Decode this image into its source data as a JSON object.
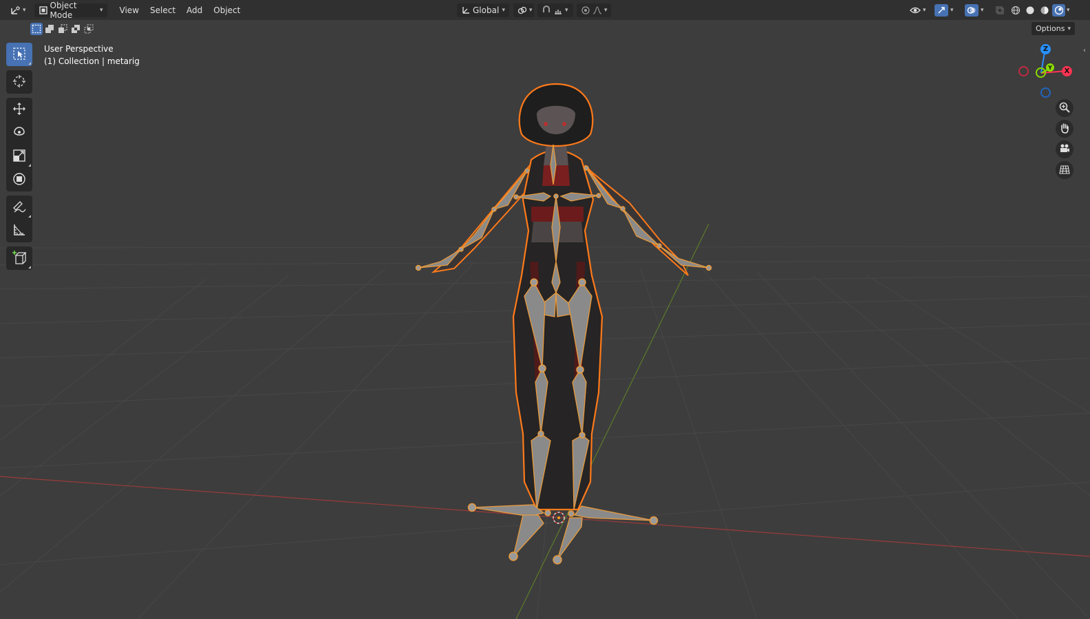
{
  "header": {
    "mode_label": "Object Mode",
    "menus": [
      "View",
      "Select",
      "Add",
      "Object"
    ],
    "orientation_label": "Global"
  },
  "subheader": {
    "options_label": "Options"
  },
  "viewport": {
    "perspective_label": "User Perspective",
    "collection_label": "(1) Collection | metarig"
  },
  "gizmo": {
    "z_label": "Z",
    "y_label": "Y",
    "x_label": "X"
  },
  "colors": {
    "accent": "#4772b3",
    "header_bg": "#303030",
    "viewport_bg": "#3d3d3d",
    "selection_orange": "#ff7a1a",
    "x_axis": "#ff3352",
    "y_axis": "#8bdc00",
    "z_axis": "#2890ff"
  },
  "icons": {
    "editor_type": "editor-type-icon",
    "object_mode": "object-mode-icon",
    "orientation": "transform-orientation-icon",
    "pivot": "pivot-point-icon",
    "snap": "snap-icon",
    "proportional": "proportional-editing-icon",
    "visibility": "visibility-icon",
    "gizmo": "gizmo-icon",
    "overlay": "overlay-icon",
    "xray": "xray-icon",
    "shading": [
      "wireframe-shading-icon",
      "solid-shading-icon",
      "material-shading-icon",
      "rendered-shading-icon"
    ]
  }
}
